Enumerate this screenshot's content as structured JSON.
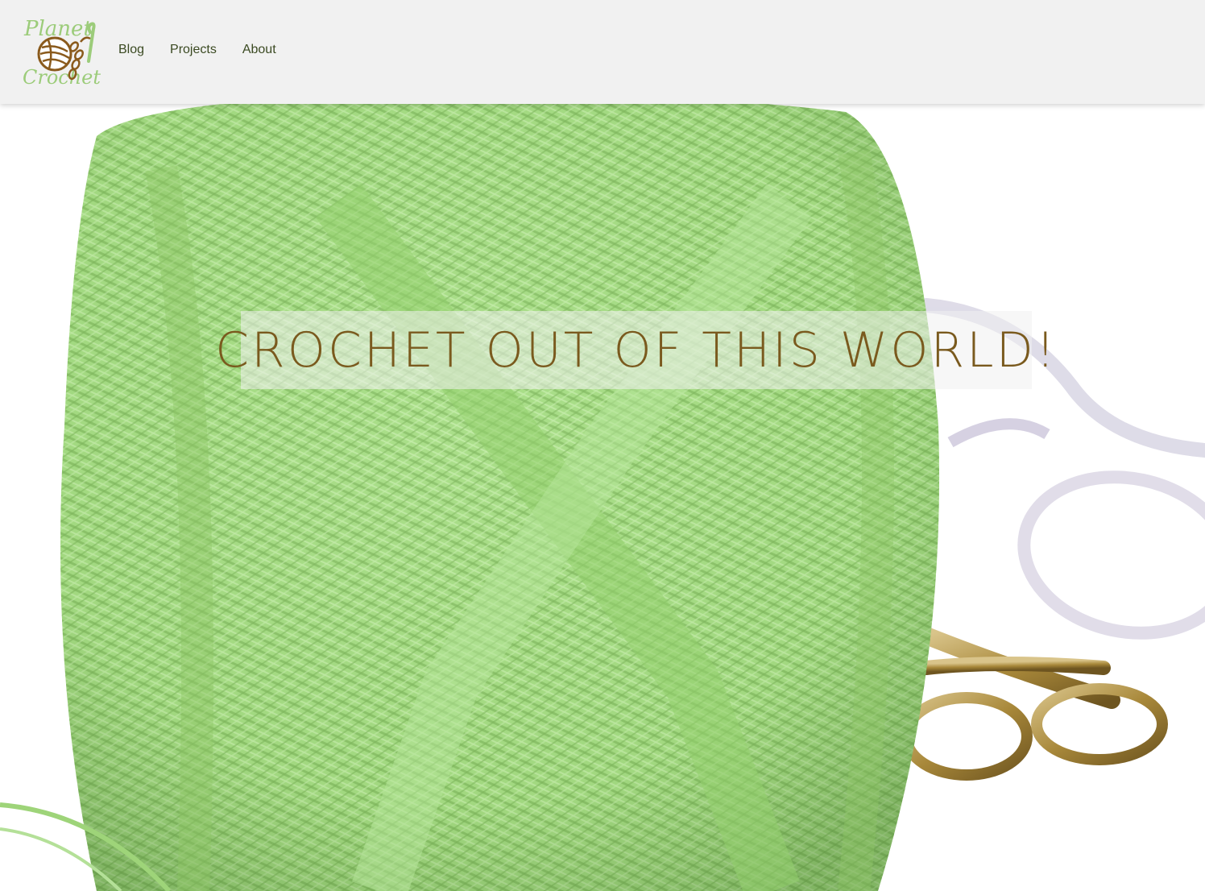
{
  "header": {
    "logo": {
      "alt_text": "Planet Crochet",
      "line1": "Planet",
      "line2": "Crochet",
      "icon": "yarn-ball-hook-icon"
    },
    "nav": [
      {
        "label": "Blog"
      },
      {
        "label": "Projects"
      },
      {
        "label": "About"
      }
    ]
  },
  "hero": {
    "headline": "CROCHET OUT OF THIS WORLD!",
    "image": "green-crochet-thread-ball-with-scissors-and-glasses"
  },
  "colors": {
    "header_bg": "#f1f1f1",
    "nav_text": "#3b4a22",
    "headline": "#7a5a1e",
    "logo_green": "#9ccc7a",
    "logo_brown": "#8a5a1c",
    "yarn_green": "#a6dd84"
  }
}
